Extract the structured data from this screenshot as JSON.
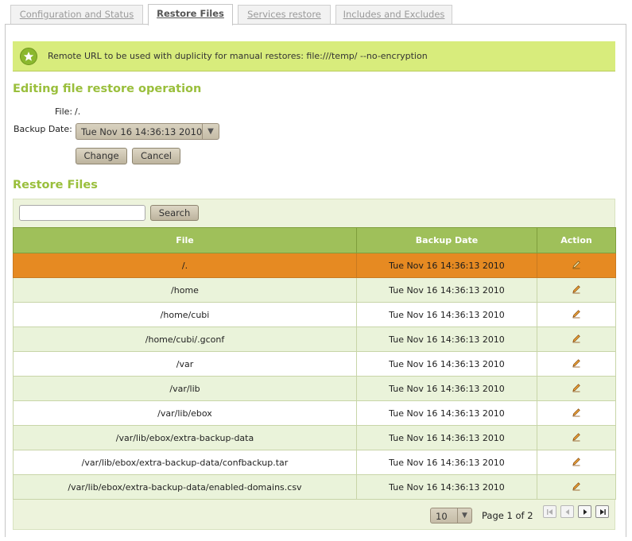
{
  "tabs": [
    {
      "label": "Configuration and Status",
      "active": false
    },
    {
      "label": "Restore Files",
      "active": true
    },
    {
      "label": "Services restore",
      "active": false
    },
    {
      "label": "Includes and Excludes",
      "active": false
    }
  ],
  "note": {
    "text": "Remote URL to be used with duplicity for manual restores: file:///temp/ --no-encryption"
  },
  "edit_section": {
    "title": "Editing file restore operation",
    "file_label": "File:",
    "file_value": "/.",
    "date_label": "Backup Date:",
    "date_value": "Tue Nov 16 14:36:13 2010",
    "change_button": "Change",
    "cancel_button": "Cancel"
  },
  "restore_section": {
    "title": "Restore Files",
    "search_placeholder": "",
    "search_button": "Search",
    "columns": [
      "File",
      "Backup Date",
      "Action"
    ],
    "rows": [
      {
        "file": "/.",
        "date": "Tue Nov 16 14:36:13 2010",
        "selected": true
      },
      {
        "file": "/home",
        "date": "Tue Nov 16 14:36:13 2010",
        "selected": false
      },
      {
        "file": "/home/cubi",
        "date": "Tue Nov 16 14:36:13 2010",
        "selected": false
      },
      {
        "file": "/home/cubi/.gconf",
        "date": "Tue Nov 16 14:36:13 2010",
        "selected": false
      },
      {
        "file": "/var",
        "date": "Tue Nov 16 14:36:13 2010",
        "selected": false
      },
      {
        "file": "/var/lib",
        "date": "Tue Nov 16 14:36:13 2010",
        "selected": false
      },
      {
        "file": "/var/lib/ebox",
        "date": "Tue Nov 16 14:36:13 2010",
        "selected": false
      },
      {
        "file": "/var/lib/ebox/extra-backup-data",
        "date": "Tue Nov 16 14:36:13 2010",
        "selected": false
      },
      {
        "file": "/var/lib/ebox/extra-backup-data/confbackup.tar",
        "date": "Tue Nov 16 14:36:13 2010",
        "selected": false
      },
      {
        "file": "/var/lib/ebox/extra-backup-data/enabled-domains.csv",
        "date": "Tue Nov 16 14:36:13 2010",
        "selected": false
      }
    ],
    "page_size": "10",
    "page_info": "Page 1 of 2"
  },
  "colors": {
    "accent_green": "#9abf3c",
    "header_green": "#9fc05a",
    "selected_row": "#e68a22",
    "note_bg": "#d8ec7c"
  },
  "icons": [
    "star-icon",
    "pencil-icon",
    "first-page-icon",
    "prev-page-icon",
    "next-page-icon",
    "last-page-icon",
    "dropdown-arrow-icon"
  ]
}
